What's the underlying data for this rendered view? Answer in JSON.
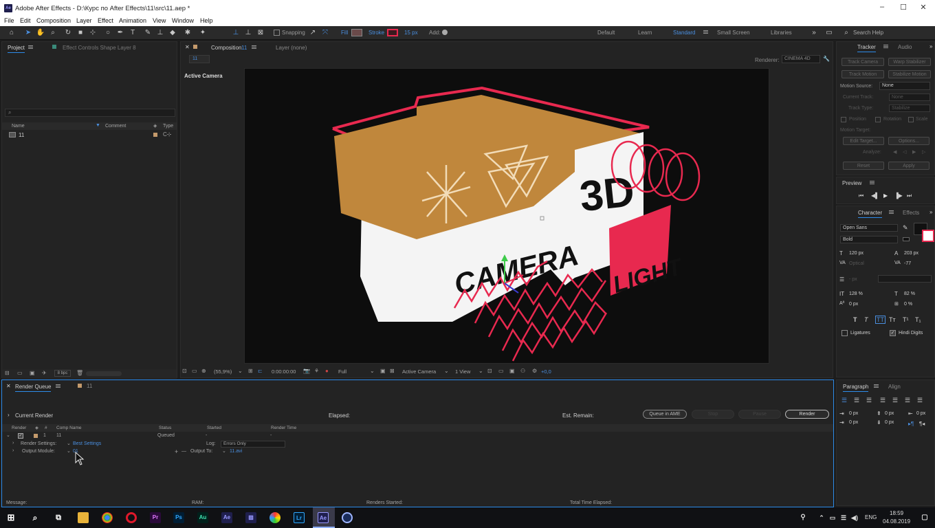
{
  "window": {
    "title": "Adobe After Effects - D:\\Курс по After Effects\\11\\src\\11.aep *",
    "app_badge": "Ae"
  },
  "menu": [
    "File",
    "Edit",
    "Composition",
    "Layer",
    "Effect",
    "Animation",
    "View",
    "Window",
    "Help"
  ],
  "toolbar": {
    "snapping": "Snapping",
    "fill": "Fill",
    "stroke": "Stroke",
    "stroke_width": "15 px",
    "add": "Add:",
    "workspaces": [
      "Default",
      "Learn",
      "Standard",
      "Small Screen",
      "Libraries"
    ],
    "active_workspace": "Standard",
    "search_placeholder": "Search Help"
  },
  "project_panel": {
    "tab_project": "Project",
    "tab_effect_controls": "Effect Controls Shape Layer 8",
    "columns": [
      "Name",
      "Comment",
      "Type"
    ],
    "items": [
      {
        "name": "11"
      }
    ],
    "bpc": "8 bpc"
  },
  "composition_panel": {
    "tab_label": "Composition",
    "comp_name": "11",
    "layer_tab": "Layer (none)",
    "breadcrumb": "11",
    "renderer_label": "Renderer:",
    "renderer": "CINEMA 4D",
    "active_camera_label": "Active Camera",
    "artwork_text": {
      "camera": "CAMERA",
      "threed": "3D",
      "light": "LIGHT"
    },
    "footer": {
      "zoom": "(55,9%)",
      "timecode": "0:00:00:00",
      "resolution": "Full",
      "view": "Active Camera",
      "views": "1 View",
      "exposure": "+0,0"
    }
  },
  "render_queue": {
    "tab_render_queue": "Render Queue",
    "tab_comp": "11",
    "current_render": "Current Render",
    "elapsed": "Elapsed:",
    "est_remain": "Est. Remain:",
    "queue_in_ame": "Queue in AME",
    "stop": "Stop",
    "pause": "Pause",
    "render": "Render",
    "columns": [
      "Render",
      "#",
      "Comp Name",
      "Status",
      "Started",
      "Render Time"
    ],
    "item": {
      "index": "1",
      "comp_name": "11",
      "status": "Queued",
      "started": "-",
      "render_time": "-",
      "render_settings_label": "Render Settings:",
      "render_settings_value": "Best Settings",
      "log_label": "Log:",
      "log_value": "Errors Only",
      "output_module_label": "Output Module:",
      "output_module_value": "01",
      "output_to_label": "Output To:",
      "output_to_value": "11.avi"
    },
    "status_bar": {
      "message": "Message:",
      "ram": "RAM:",
      "renders_started": "Renders Started:",
      "total_time": "Total Time Elapsed:"
    }
  },
  "tracker_panel": {
    "tab_tracker": "Tracker",
    "tab_audio": "Audio",
    "track_camera": "Track Camera",
    "warp_stabilizer": "Warp Stabilizer",
    "track_motion": "Track Motion",
    "stabilize_motion": "Stabilize Motion",
    "motion_source_label": "Motion Source:",
    "motion_source": "None",
    "current_track_label": "Current Track:",
    "current_track": "None",
    "track_type_label": "Track Type:",
    "track_type": "Stabilize",
    "position": "Position",
    "rotation": "Rotation",
    "scale": "Scale",
    "motion_target": "Motion Target:",
    "edit_target": "Edit Target...",
    "options": "Options...",
    "analyze": "Analyze:",
    "reset": "Reset",
    "apply": "Apply"
  },
  "preview_panel": {
    "title": "Preview"
  },
  "character_panel": {
    "tab_character": "Character",
    "tab_effects": "Effects",
    "font": "Open Sans",
    "style": "Bold",
    "font_size": "120 px",
    "leading": "203 px",
    "kerning": "Optical",
    "tracking": "-77",
    "stroke_width": "- px",
    "vert_scale": "128 %",
    "horiz_scale": "82 %",
    "baseline": "0 px",
    "tsume": "0 %",
    "ligatures": "Ligatures",
    "hindi_digits": "Hindi Digits"
  },
  "paragraph_panel": {
    "tab_paragraph": "Paragraph",
    "tab_align": "Align",
    "values": [
      "0 px",
      "0 px",
      "0 px",
      "0 px",
      "0 px"
    ]
  },
  "taskbar": {
    "apps": [
      "Pr",
      "Ps",
      "Au",
      "Ae",
      "Lr",
      "Ae"
    ],
    "lang": "ENG",
    "time": "18:59",
    "date": "04.08.2019"
  },
  "colors": {
    "accent": "#2d8ceb",
    "brand_orange": "#c0873c",
    "pink": "#e8294f",
    "panel_bg": "#232323"
  }
}
